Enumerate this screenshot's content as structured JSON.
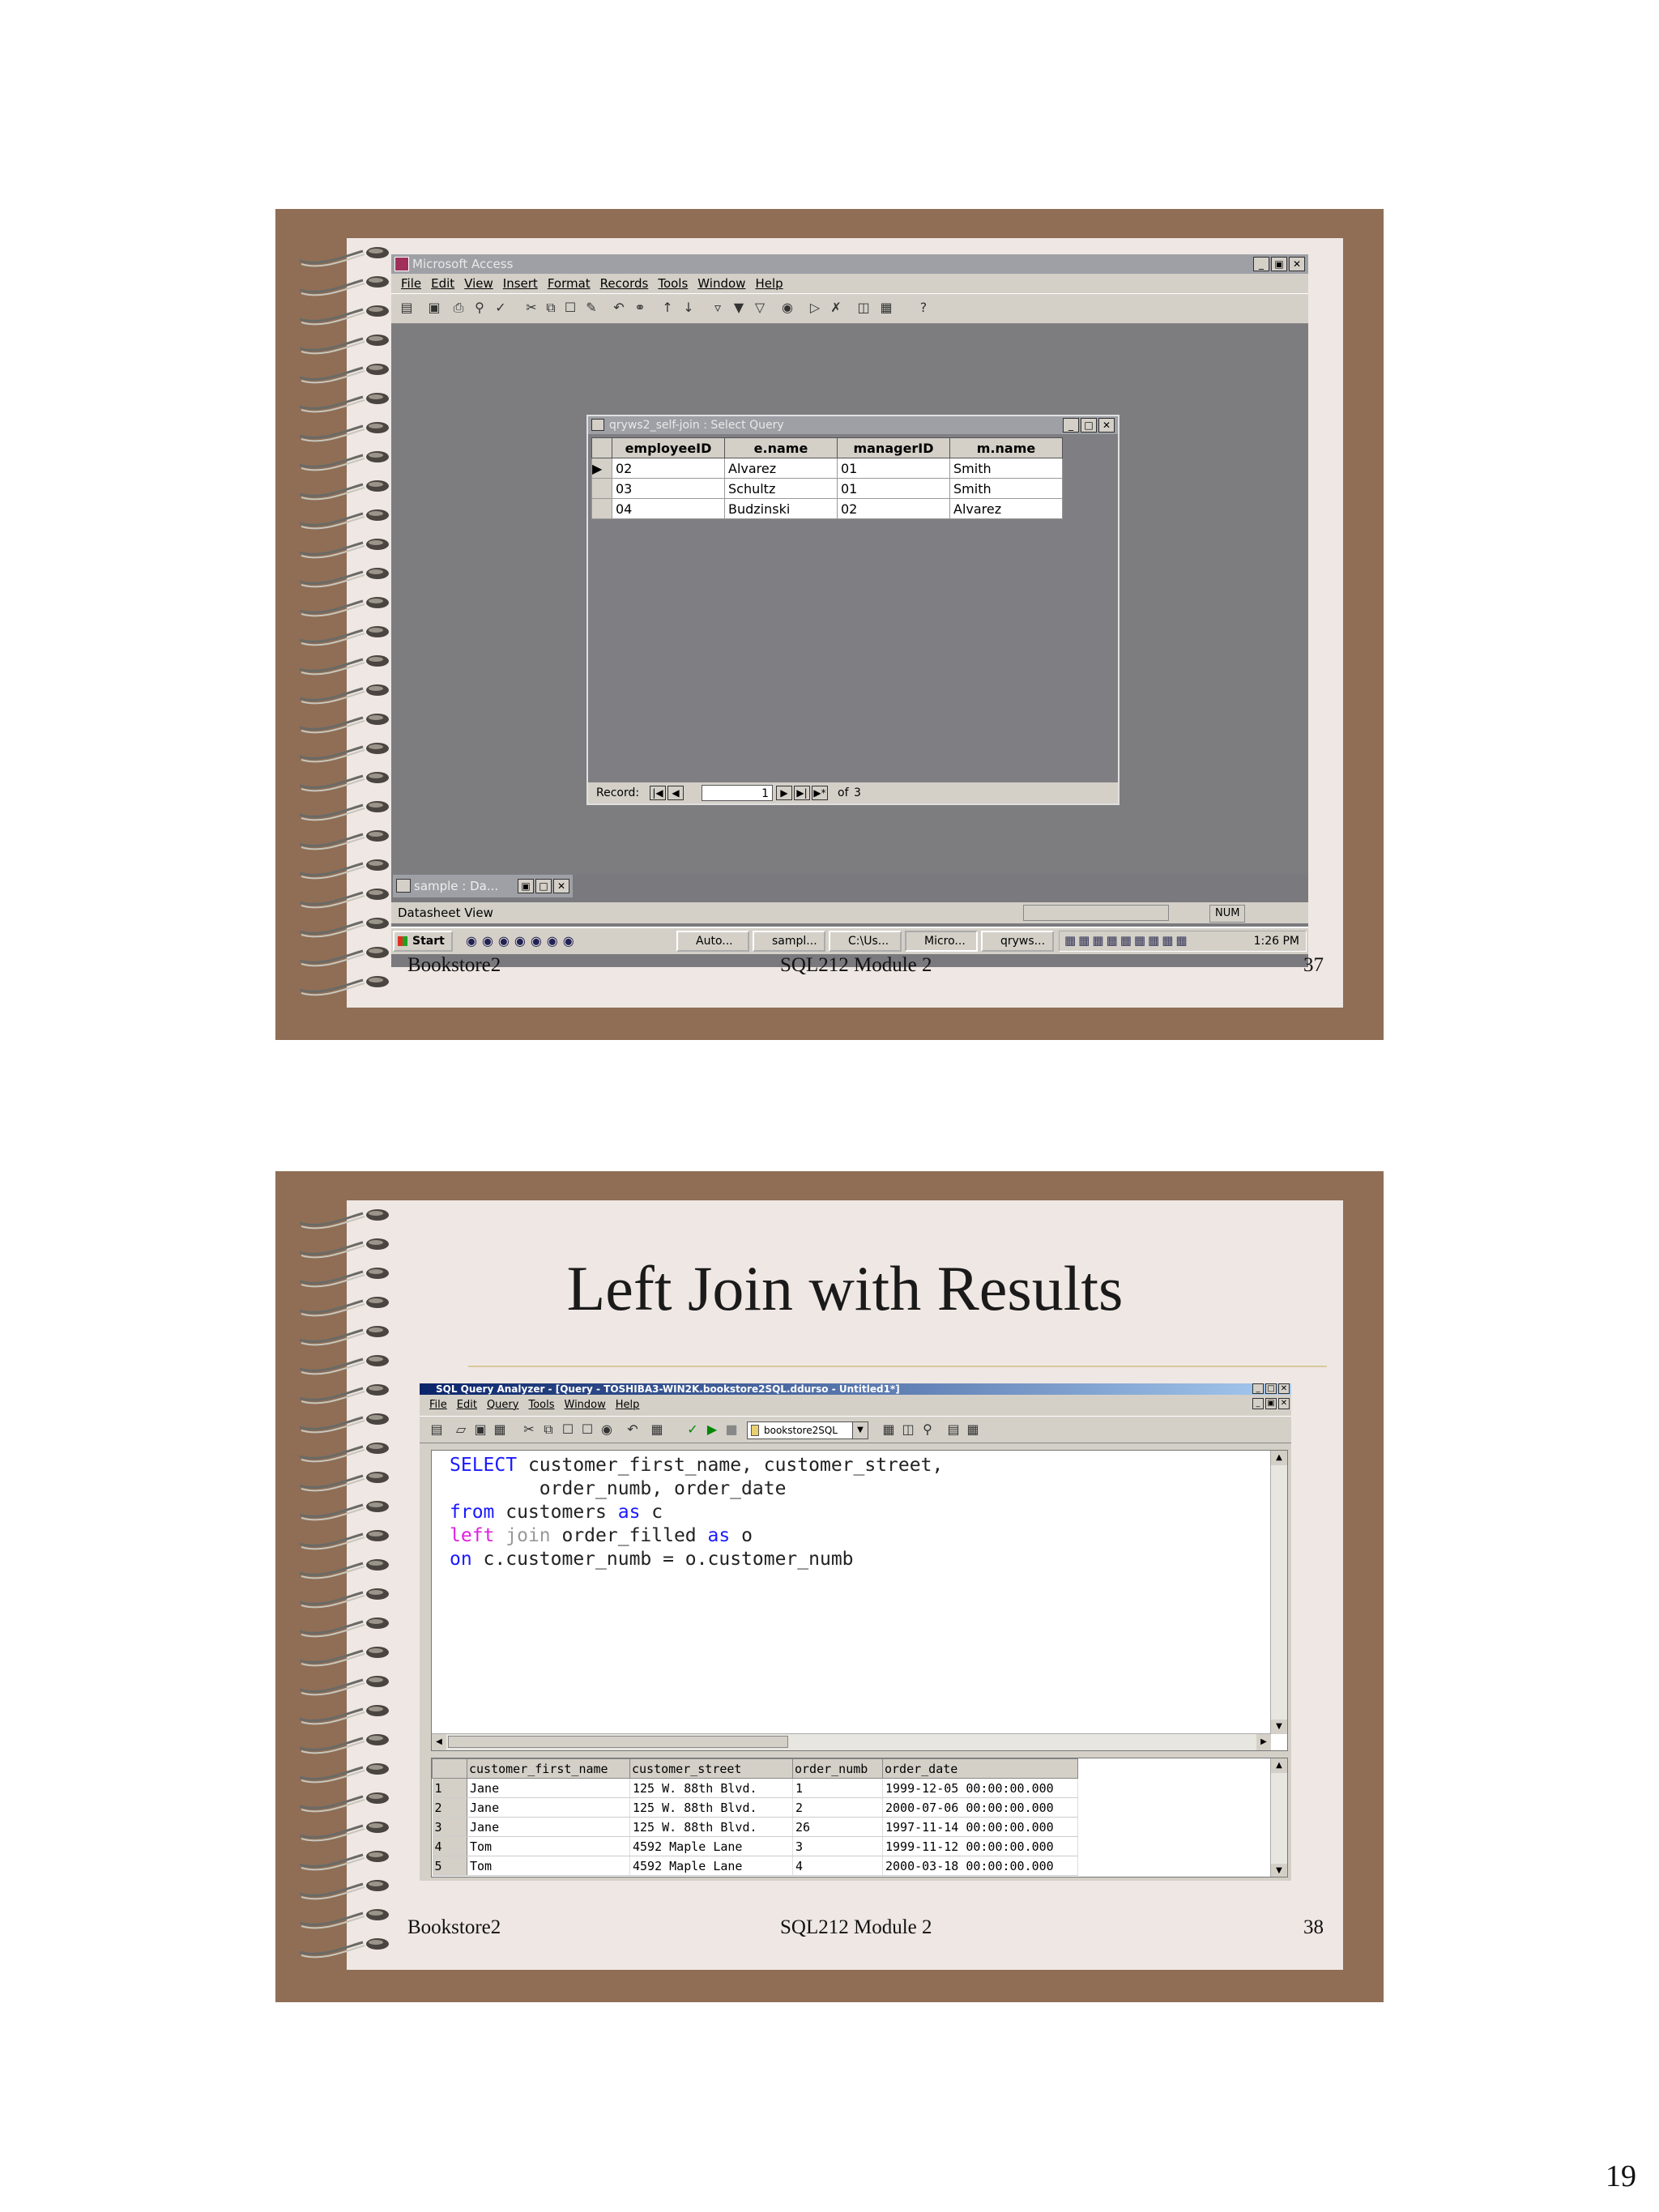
{
  "page_number": "19",
  "slides": [
    {
      "footer": {
        "left": "Bookstore2",
        "middle": "SQL212  Module 2",
        "right": "37"
      },
      "app": {
        "title": "Microsoft Access",
        "menu": [
          "File",
          "Edit",
          "View",
          "Insert",
          "Format",
          "Records",
          "Tools",
          "Window",
          "Help"
        ],
        "query_window": {
          "title": "qryws2_self-join : Select Query",
          "columns": [
            "employeeID",
            "e.name",
            "managerID",
            "m.name"
          ],
          "rows": [
            [
              "02",
              "Alvarez",
              "01",
              "Smith"
            ],
            [
              "03",
              "Schultz",
              "01",
              "Smith"
            ],
            [
              "04",
              "Budzinski",
              "02",
              "Alvarez"
            ]
          ],
          "nav": {
            "record_label": "Record:",
            "current": "1",
            "of_label": "of",
            "total": "3"
          }
        },
        "minimized_window": "sample : Da...",
        "status_bar": {
          "left": "Datasheet View",
          "num": "NUM"
        },
        "taskbar": {
          "start": "Start",
          "buttons": [
            "Auto...",
            "sampl...",
            "C:\\Us...",
            "Micro...",
            "qryws..."
          ],
          "clock": "1:26 PM"
        }
      }
    },
    {
      "title": "Left Join with Results",
      "footer": {
        "left": "Bookstore2",
        "middle": "SQL212  Module 2",
        "right": "38"
      },
      "app": {
        "title": "SQL Query Analyzer - [Query - TOSHIBA3-WIN2K.bookstore2SQL.ddurso - Untitled1*]",
        "menu": [
          "File",
          "Edit",
          "Query",
          "Tools",
          "Window",
          "Help"
        ],
        "database": "bookstore2SQL",
        "sql": [
          [
            {
              "t": "SELECT",
              "c": "#1a1aff"
            },
            {
              "t": " customer_first_name, customer_street,",
              "c": "#222"
            }
          ],
          [
            {
              "t": "        order_numb, order_date",
              "c": "#222"
            }
          ],
          [
            {
              "t": "from",
              "c": "#1a1aff"
            },
            {
              "t": " customers ",
              "c": "#222"
            },
            {
              "t": "as",
              "c": "#1a1aff"
            },
            {
              "t": " c",
              "c": "#222"
            }
          ],
          [
            {
              "t": "left",
              "c": "#e020e0"
            },
            {
              "t": " ",
              "c": "#222"
            },
            {
              "t": "join",
              "c": "#999"
            },
            {
              "t": " order_filled ",
              "c": "#222"
            },
            {
              "t": "as",
              "c": "#1a1aff"
            },
            {
              "t": " o",
              "c": "#222"
            }
          ],
          [
            {
              "t": "on",
              "c": "#1a1aff"
            },
            {
              "t": " c.customer_numb = o.customer_numb",
              "c": "#222"
            }
          ]
        ],
        "results": {
          "columns": [
            "customer_first_name",
            "customer_street",
            "order_numb",
            "order_date"
          ],
          "rows": [
            [
              "1",
              "Jane",
              "125 W. 88th Blvd.",
              "1",
              "1999-12-05 00:00:00.000"
            ],
            [
              "2",
              "Jane",
              "125 W. 88th Blvd.",
              "2",
              "2000-07-06 00:00:00.000"
            ],
            [
              "3",
              "Jane",
              "125 W. 88th Blvd.",
              "26",
              "1997-11-14 00:00:00.000"
            ],
            [
              "4",
              "Tom",
              "4592 Maple Lane",
              "3",
              "1999-11-12 00:00:00.000"
            ],
            [
              "5",
              "Tom",
              "4592 Maple Lane",
              "4",
              "2000-03-18 00:00:00.000"
            ]
          ]
        }
      }
    }
  ]
}
